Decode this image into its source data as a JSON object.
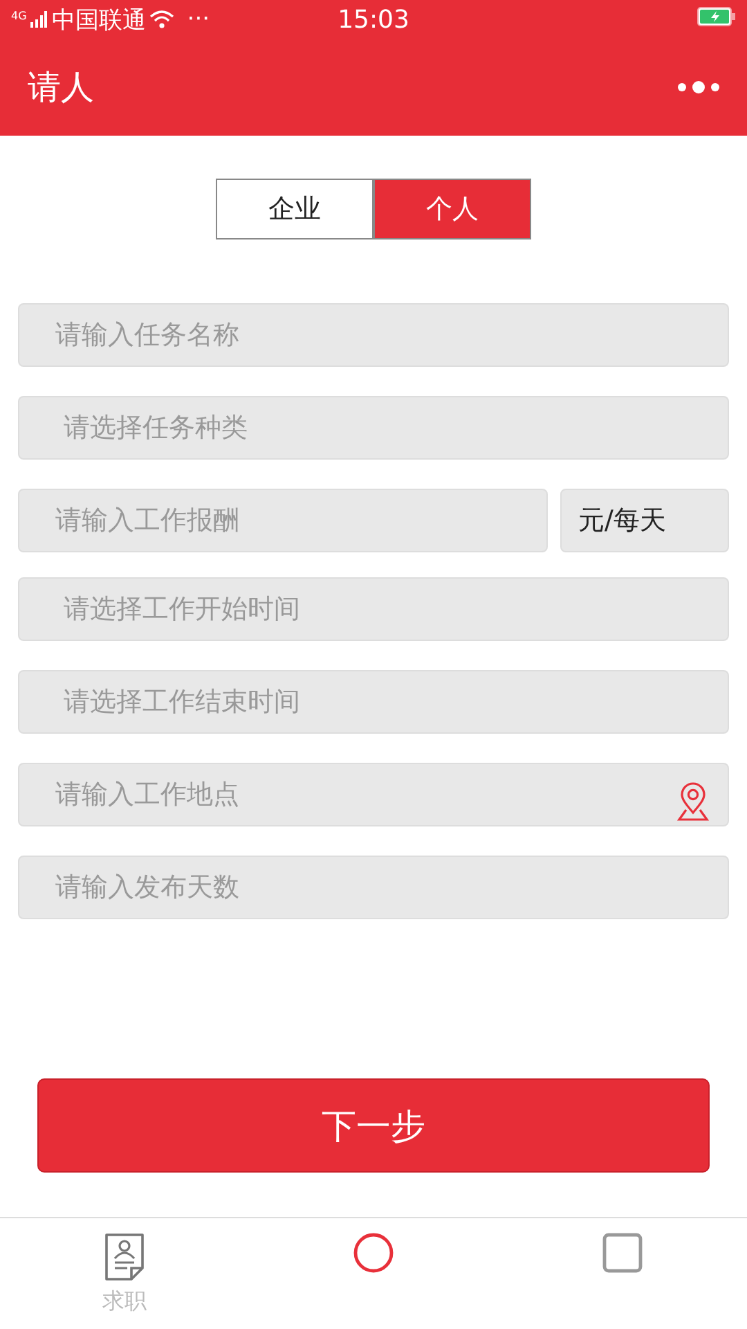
{
  "status_bar": {
    "network": "4G",
    "carrier": "中国联通",
    "more": "···",
    "time": "15:03"
  },
  "nav_bar": {
    "title": "请人"
  },
  "segment": [
    {
      "label": "企业",
      "selected": false
    },
    {
      "label": "个人",
      "selected": true
    }
  ],
  "fields": [
    {
      "kind": "input",
      "placeholder": "请输入任务名称"
    },
    {
      "kind": "select",
      "placeholder": "请选择任务种类"
    },
    {
      "kind": "pay",
      "placeholder": "请输入工作报酬",
      "unit": "元/每天"
    },
    {
      "kind": "select",
      "placeholder": "请选择工作开始时间"
    },
    {
      "kind": "select",
      "placeholder": "请选择工作结束时间"
    },
    {
      "kind": "location",
      "placeholder": "请输入工作地点"
    },
    {
      "kind": "input",
      "placeholder": "请输入发布天数"
    }
  ],
  "next_button": {
    "label": "下一步"
  },
  "tab_bar": [
    {
      "kind": "resume",
      "label": "求职"
    },
    {
      "kind": "circle"
    },
    {
      "kind": "square"
    }
  ]
}
